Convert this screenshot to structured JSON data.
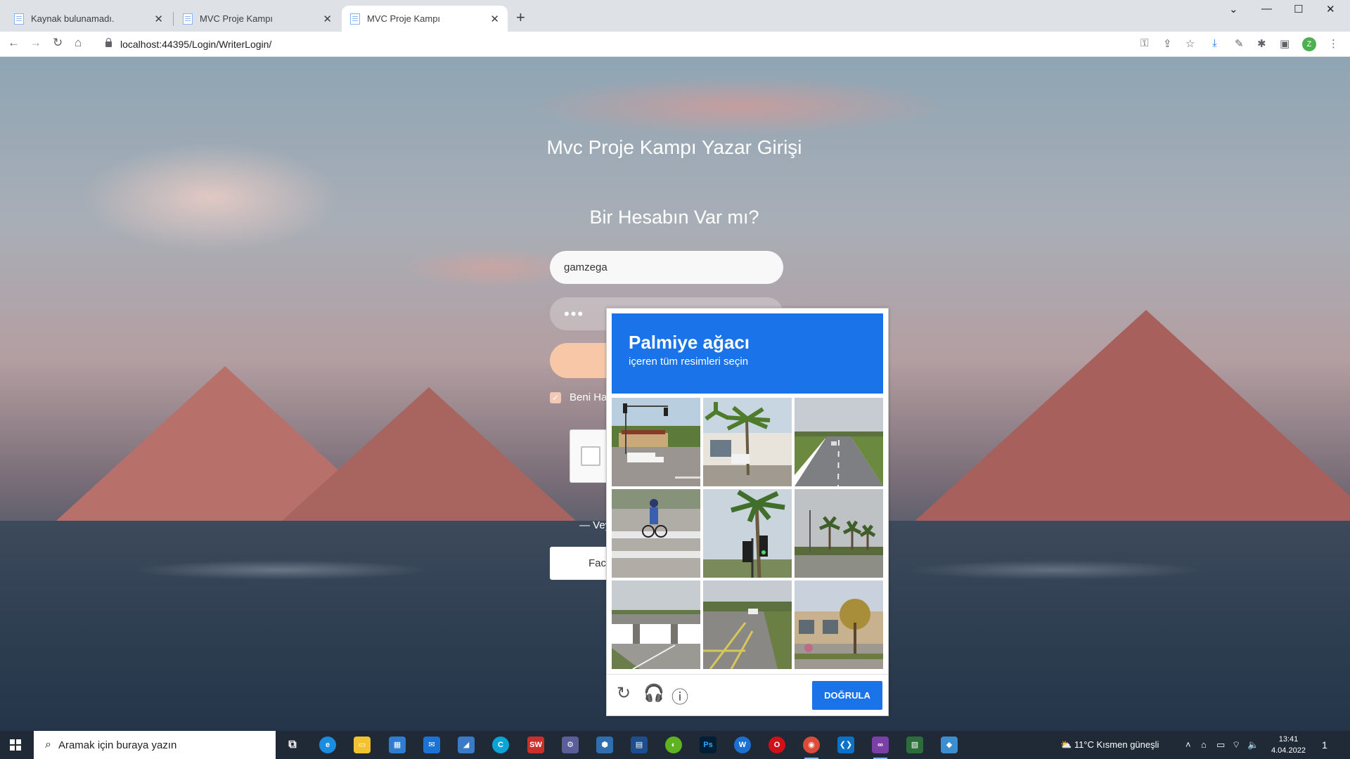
{
  "browser": {
    "tabs": [
      {
        "title": "Kaynak bulunamadı.",
        "active": false
      },
      {
        "title": "MVC Proje Kampı",
        "active": false
      },
      {
        "title": "MVC Proje Kampı",
        "active": true
      }
    ],
    "new_tab": "+",
    "address": "localhost:44395/Login/WriterLogin/",
    "profile_initial": "Z"
  },
  "page": {
    "title": "Mvc Proje Kampı Yazar Girişi",
    "subtitle": "Bir Hesabın Var mı?",
    "username_value": "gamzega",
    "password_mask": "•••",
    "remember_label": "Beni Ha",
    "or_text": "— Vey",
    "facebook_label": "Fac"
  },
  "captcha": {
    "strong_text": "Palmiye ağacı",
    "instruction": "içeren tüm resimleri seçin",
    "verify_label": "DOĞRULA",
    "tiles": [
      {
        "name": "street-intersection",
        "palm": false
      },
      {
        "name": "street-palms-building",
        "palm": true
      },
      {
        "name": "highway",
        "palm": false
      },
      {
        "name": "cyclist-crosswalk",
        "palm": false
      },
      {
        "name": "palm-traffic-light",
        "palm": true
      },
      {
        "name": "palms-distance",
        "palm": true
      },
      {
        "name": "overpass",
        "palm": false
      },
      {
        "name": "parking-lot",
        "palm": false
      },
      {
        "name": "storefront-trees",
        "palm": false
      }
    ],
    "accent_color": "#1a73e8"
  },
  "taskbar": {
    "search_placeholder": "Aramak için buraya yazın",
    "weather": "11°C  Kısmen güneşli",
    "time": "13:41",
    "date": "4.04.2022",
    "notification_count": "1"
  }
}
